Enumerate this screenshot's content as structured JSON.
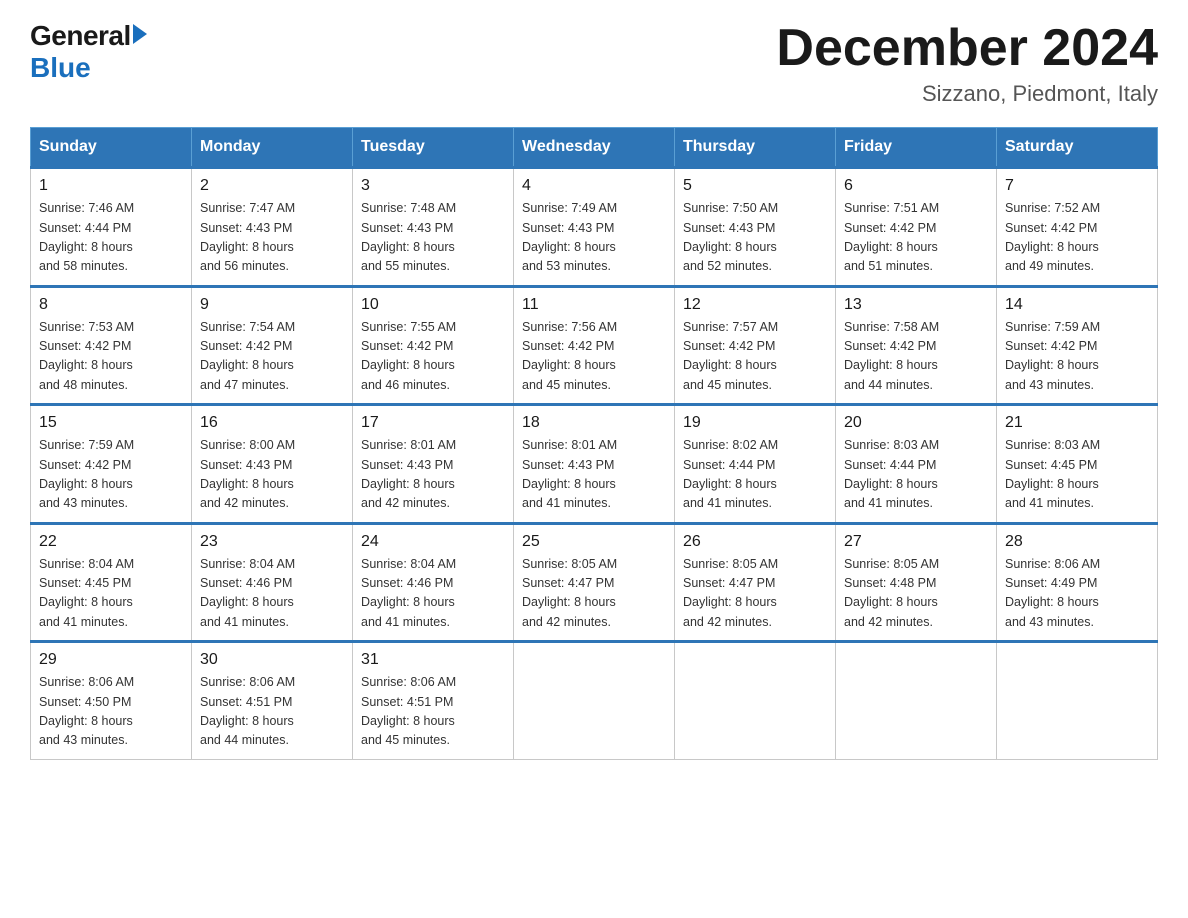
{
  "logo": {
    "general": "General",
    "blue": "Blue"
  },
  "title": "December 2024",
  "subtitle": "Sizzano, Piedmont, Italy",
  "days": [
    "Sunday",
    "Monday",
    "Tuesday",
    "Wednesday",
    "Thursday",
    "Friday",
    "Saturday"
  ],
  "weeks": [
    [
      {
        "day": "1",
        "sunrise": "7:46 AM",
        "sunset": "4:44 PM",
        "daylight": "8 hours and 58 minutes."
      },
      {
        "day": "2",
        "sunrise": "7:47 AM",
        "sunset": "4:43 PM",
        "daylight": "8 hours and 56 minutes."
      },
      {
        "day": "3",
        "sunrise": "7:48 AM",
        "sunset": "4:43 PM",
        "daylight": "8 hours and 55 minutes."
      },
      {
        "day": "4",
        "sunrise": "7:49 AM",
        "sunset": "4:43 PM",
        "daylight": "8 hours and 53 minutes."
      },
      {
        "day": "5",
        "sunrise": "7:50 AM",
        "sunset": "4:43 PM",
        "daylight": "8 hours and 52 minutes."
      },
      {
        "day": "6",
        "sunrise": "7:51 AM",
        "sunset": "4:42 PM",
        "daylight": "8 hours and 51 minutes."
      },
      {
        "day": "7",
        "sunrise": "7:52 AM",
        "sunset": "4:42 PM",
        "daylight": "8 hours and 49 minutes."
      }
    ],
    [
      {
        "day": "8",
        "sunrise": "7:53 AM",
        "sunset": "4:42 PM",
        "daylight": "8 hours and 48 minutes."
      },
      {
        "day": "9",
        "sunrise": "7:54 AM",
        "sunset": "4:42 PM",
        "daylight": "8 hours and 47 minutes."
      },
      {
        "day": "10",
        "sunrise": "7:55 AM",
        "sunset": "4:42 PM",
        "daylight": "8 hours and 46 minutes."
      },
      {
        "day": "11",
        "sunrise": "7:56 AM",
        "sunset": "4:42 PM",
        "daylight": "8 hours and 45 minutes."
      },
      {
        "day": "12",
        "sunrise": "7:57 AM",
        "sunset": "4:42 PM",
        "daylight": "8 hours and 45 minutes."
      },
      {
        "day": "13",
        "sunrise": "7:58 AM",
        "sunset": "4:42 PM",
        "daylight": "8 hours and 44 minutes."
      },
      {
        "day": "14",
        "sunrise": "7:59 AM",
        "sunset": "4:42 PM",
        "daylight": "8 hours and 43 minutes."
      }
    ],
    [
      {
        "day": "15",
        "sunrise": "7:59 AM",
        "sunset": "4:42 PM",
        "daylight": "8 hours and 43 minutes."
      },
      {
        "day": "16",
        "sunrise": "8:00 AM",
        "sunset": "4:43 PM",
        "daylight": "8 hours and 42 minutes."
      },
      {
        "day": "17",
        "sunrise": "8:01 AM",
        "sunset": "4:43 PM",
        "daylight": "8 hours and 42 minutes."
      },
      {
        "day": "18",
        "sunrise": "8:01 AM",
        "sunset": "4:43 PM",
        "daylight": "8 hours and 41 minutes."
      },
      {
        "day": "19",
        "sunrise": "8:02 AM",
        "sunset": "4:44 PM",
        "daylight": "8 hours and 41 minutes."
      },
      {
        "day": "20",
        "sunrise": "8:03 AM",
        "sunset": "4:44 PM",
        "daylight": "8 hours and 41 minutes."
      },
      {
        "day": "21",
        "sunrise": "8:03 AM",
        "sunset": "4:45 PM",
        "daylight": "8 hours and 41 minutes."
      }
    ],
    [
      {
        "day": "22",
        "sunrise": "8:04 AM",
        "sunset": "4:45 PM",
        "daylight": "8 hours and 41 minutes."
      },
      {
        "day": "23",
        "sunrise": "8:04 AM",
        "sunset": "4:46 PM",
        "daylight": "8 hours and 41 minutes."
      },
      {
        "day": "24",
        "sunrise": "8:04 AM",
        "sunset": "4:46 PM",
        "daylight": "8 hours and 41 minutes."
      },
      {
        "day": "25",
        "sunrise": "8:05 AM",
        "sunset": "4:47 PM",
        "daylight": "8 hours and 42 minutes."
      },
      {
        "day": "26",
        "sunrise": "8:05 AM",
        "sunset": "4:47 PM",
        "daylight": "8 hours and 42 minutes."
      },
      {
        "day": "27",
        "sunrise": "8:05 AM",
        "sunset": "4:48 PM",
        "daylight": "8 hours and 42 minutes."
      },
      {
        "day": "28",
        "sunrise": "8:06 AM",
        "sunset": "4:49 PM",
        "daylight": "8 hours and 43 minutes."
      }
    ],
    [
      {
        "day": "29",
        "sunrise": "8:06 AM",
        "sunset": "4:50 PM",
        "daylight": "8 hours and 43 minutes."
      },
      {
        "day": "30",
        "sunrise": "8:06 AM",
        "sunset": "4:51 PM",
        "daylight": "8 hours and 44 minutes."
      },
      {
        "day": "31",
        "sunrise": "8:06 AM",
        "sunset": "4:51 PM",
        "daylight": "8 hours and 45 minutes."
      },
      null,
      null,
      null,
      null
    ]
  ],
  "labels": {
    "sunrise": "Sunrise:",
    "sunset": "Sunset:",
    "daylight": "Daylight:"
  }
}
